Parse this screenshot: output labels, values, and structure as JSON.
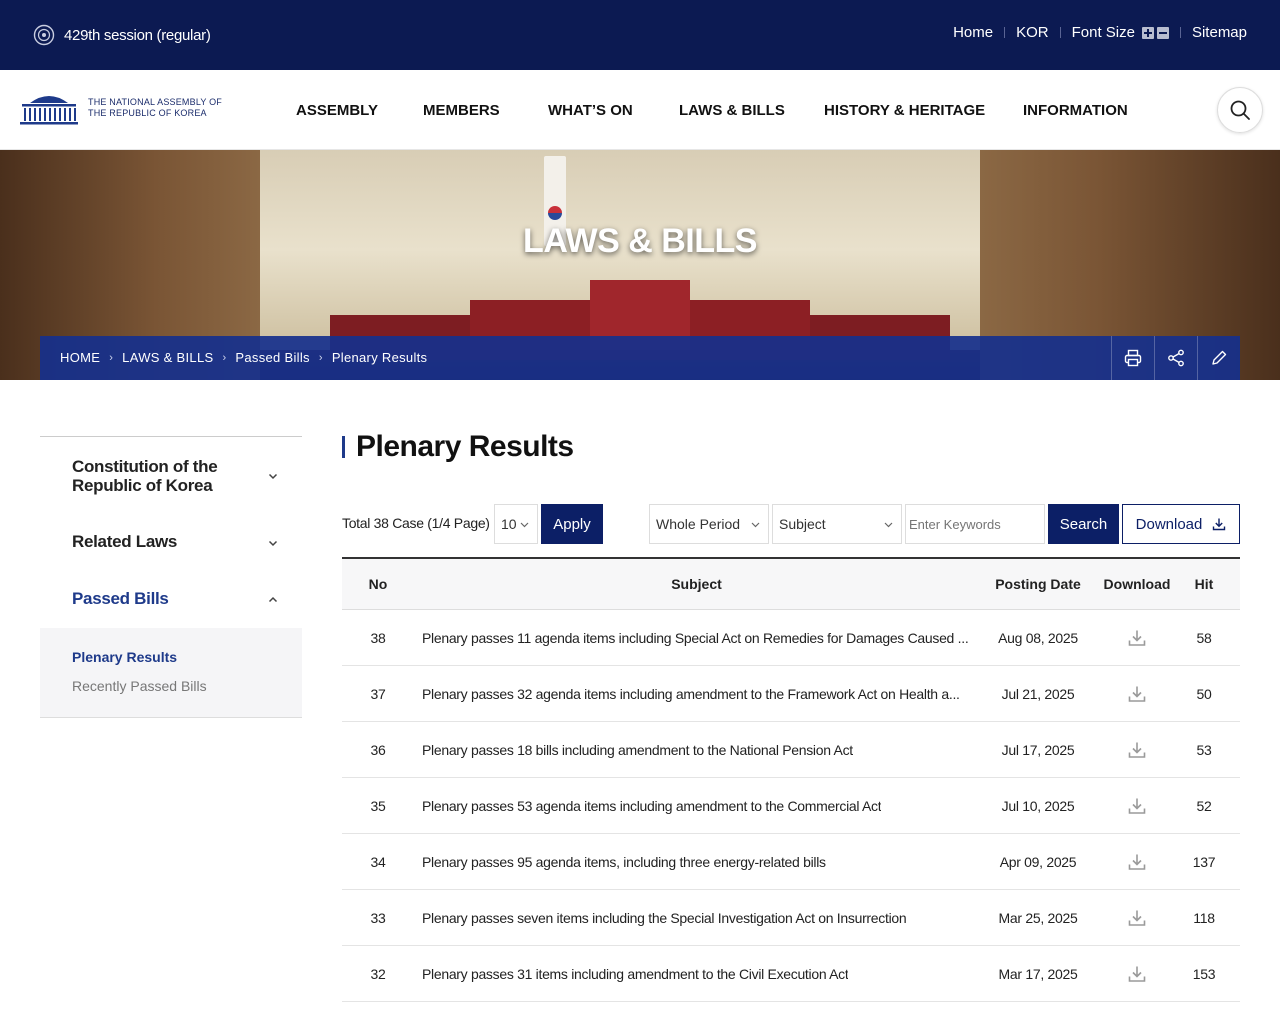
{
  "topbar": {
    "session": "429th session (regular)",
    "links": [
      "Home",
      "KOR",
      "Font Size",
      "Sitemap"
    ]
  },
  "header": {
    "logo_line1": "THE NATIONAL ASSEMBLY OF",
    "logo_line2": "THE REPUBLIC OF KOREA",
    "menu": [
      "ASSEMBLY",
      "MEMBERS",
      "WHAT’S ON",
      "LAWS & BILLS",
      "HISTORY & HERITAGE",
      "INFORMATION"
    ]
  },
  "hero": {
    "title": "LAWS & BILLS",
    "breadcrumb": [
      "HOME",
      "LAWS & BILLS",
      "Passed Bills",
      "Plenary Results"
    ]
  },
  "sidebar": {
    "items": [
      {
        "label": "Constitution of the\nRepublic of Korea",
        "line1": "Constitution of the",
        "line2": "Republic of Korea"
      },
      {
        "label": "Related Laws"
      },
      {
        "label": "Passed Bills"
      }
    ],
    "sub_items": [
      "Plenary Results",
      "Recently Passed Bills"
    ]
  },
  "main": {
    "title": "Plenary Results",
    "total": "Total 38 Case (1/4 Page)",
    "page_size": "10",
    "apply": "Apply",
    "period": "Whole Period",
    "field": "Subject",
    "keyword_placeholder": "Enter Keywords",
    "search": "Search",
    "download": "Download"
  },
  "table": {
    "headers": {
      "no": "No",
      "subject": "Subject",
      "date": "Posting Date",
      "download": "Download",
      "hit": "Hit"
    },
    "rows": [
      {
        "no": "38",
        "subject": "Plenary passes 11 agenda items including Special Act on Remedies for Damages Caused ...",
        "date": "Aug 08, 2025",
        "hit": "58"
      },
      {
        "no": "37",
        "subject": "Plenary passes 32 agenda items including amendment to the Framework Act on Health a...",
        "date": "Jul 21, 2025",
        "hit": "50"
      },
      {
        "no": "36",
        "subject": "Plenary passes 18 bills including amendment to the National Pension Act",
        "date": "Jul 17, 2025",
        "hit": "53"
      },
      {
        "no": "35",
        "subject": "Plenary passes 53 agenda items including amendment to the Commercial Act",
        "date": "Jul 10, 2025",
        "hit": "52"
      },
      {
        "no": "34",
        "subject": "Plenary passes 95 agenda items, including three energy-related bills",
        "date": "Apr 09, 2025",
        "hit": "137"
      },
      {
        "no": "33",
        "subject": "Plenary passes seven items including the Special Investigation Act on Insurrection",
        "date": "Mar 25, 2025",
        "hit": "118"
      },
      {
        "no": "32",
        "subject": "Plenary passes 31 items including amendment to the Civil Execution Act",
        "date": "Mar 17, 2025",
        "hit": "153"
      }
    ]
  },
  "colors": {
    "navy": "#0c1a52",
    "accent": "#1e3a8a",
    "button": "#0c1f66"
  }
}
